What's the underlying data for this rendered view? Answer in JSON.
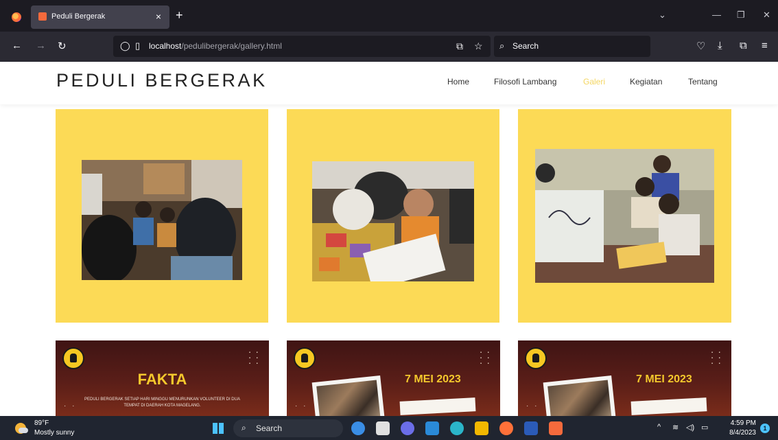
{
  "browser": {
    "tab_title": "Peduli Bergerak",
    "tab_close": "×",
    "new_tab": "+",
    "url_host": "localhost",
    "url_path": "/pedulibergerak/gallery.html",
    "search_placeholder": "Search",
    "icons": [
      "firefox-logo",
      "back-arrow",
      "forward-arrow",
      "reload",
      "shield",
      "page",
      "translate",
      "bookmark-star",
      "search",
      "pocket",
      "download",
      "extensions",
      "menu"
    ]
  },
  "site": {
    "brand": "PEDULI BERGERAK",
    "menu": [
      {
        "label": "Home",
        "active": false
      },
      {
        "label": "Filosofi Lambang",
        "active": false
      },
      {
        "label": "Galeri",
        "active": true
      },
      {
        "label": "Kegiatan",
        "active": false
      },
      {
        "label": "Tentang",
        "active": false
      }
    ],
    "accent_color": "#fcda56",
    "active_menu_color": "#f4d661",
    "posters": [
      {
        "heading": "FAKTA",
        "text": "PEDULI BERGERAK SETIAP HARI MINGGU MENURUNKAN VOLUNTEER DI DUA TEMPAT DI DAERAH KOTA MAGELANG."
      },
      {
        "heading": "7 MEI 2023"
      },
      {
        "heading": "7 MEI 2023"
      }
    ]
  },
  "taskbar": {
    "weather_temp": "89°F",
    "weather_desc": "Mostly sunny",
    "search_label": "Search",
    "time": "4:59 PM",
    "date": "8/4/2023",
    "notification_count": "1"
  }
}
